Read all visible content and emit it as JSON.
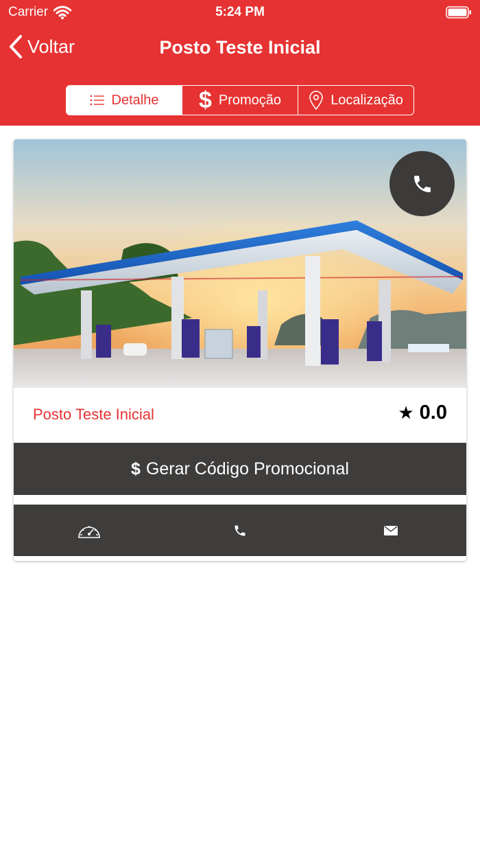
{
  "status_bar": {
    "carrier": "Carrier",
    "time": "5:24 PM"
  },
  "nav": {
    "back_label": "Voltar",
    "title": "Posto Teste Inicial"
  },
  "tabs": [
    {
      "label": "Detalhe",
      "icon": "list-icon",
      "active": true
    },
    {
      "label": "Promoção",
      "icon": "dollar-icon",
      "active": false
    },
    {
      "label": "Localização",
      "icon": "map-pin-icon",
      "active": false
    }
  ],
  "station": {
    "name": "Posto Teste Inicial",
    "rating": "0.0"
  },
  "promo_button": {
    "label": "Gerar Código Promocional"
  },
  "actions": [
    "speedometer-icon",
    "phone-icon",
    "mail-icon"
  ],
  "colors": {
    "primary": "#e63232",
    "dark": "#3f3d3c",
    "white": "#ffffff"
  }
}
